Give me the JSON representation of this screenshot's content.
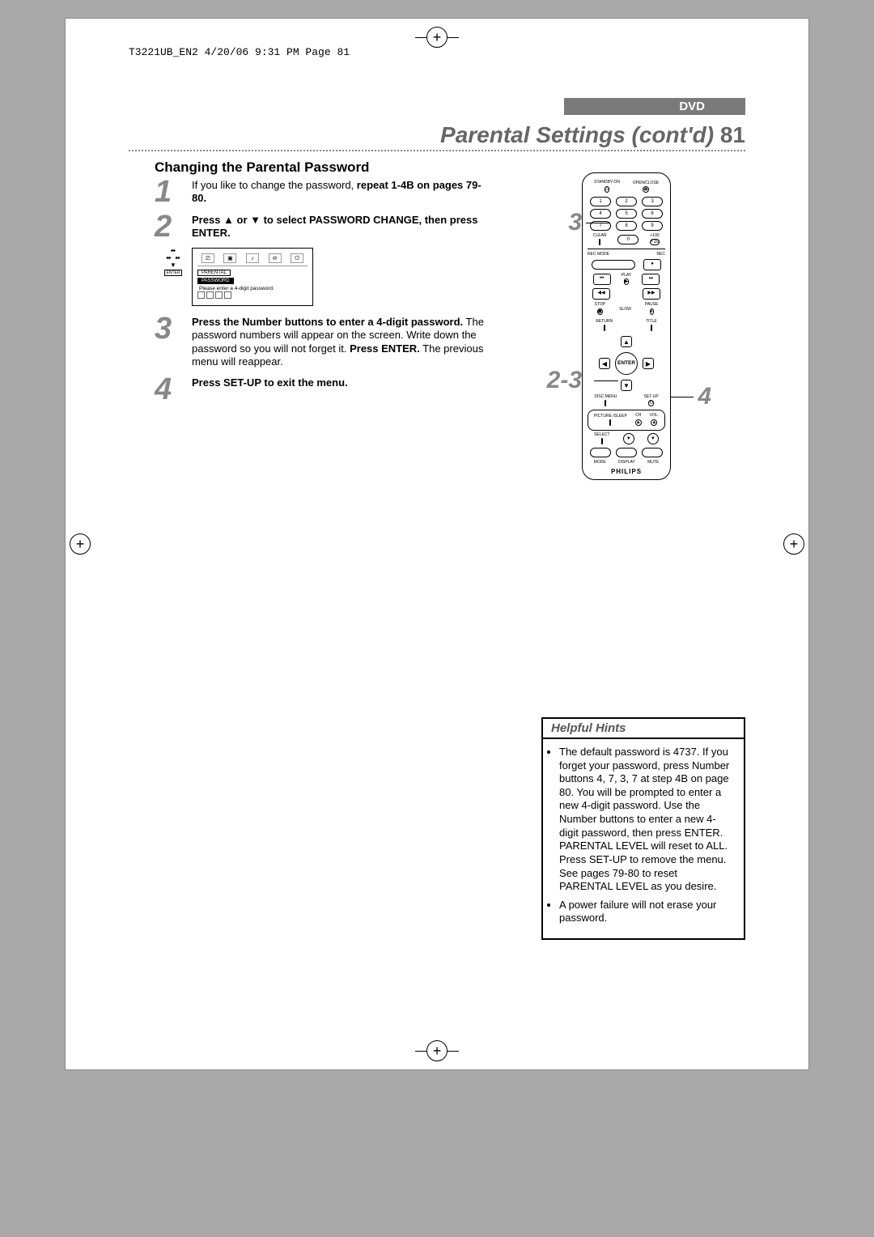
{
  "header": {
    "slug": "T3221UB_EN2  4/20/06  9:31 PM  Page 81",
    "dvd_tag": "DVD",
    "title": "Parental Settings (cont'd)",
    "page_number": "81",
    "subhead": "Changing the Parental Password"
  },
  "steps": {
    "s1": {
      "num": "1",
      "text_pre": "If you like to change the password, ",
      "text_bold": "repeat 1-4B on pages 79-80."
    },
    "s2": {
      "num": "2",
      "text_bold": "Press ▲ or ▼ to select PASSWORD CHANGE, then press ENTER."
    },
    "osd": {
      "tabs": "PARENTAL",
      "label_password": "PASSWORD",
      "prompt": "Please  enter  a  4-digit  password.",
      "hint_enter": "ENTER"
    },
    "s3": {
      "num": "3",
      "b1": "Press the Number buttons to enter a 4-digit password.",
      "t1": "  The password numbers will appear on the screen.  Write down the password so you will not forget it.  ",
      "b2": "Press ENTER.",
      "t2": "  The previous menu will reappear."
    },
    "s4": {
      "num": "4",
      "text_bold": "Press SET-UP to exit the menu."
    }
  },
  "callouts": {
    "top_left": "3",
    "mid_left": "2-3",
    "right": "4"
  },
  "remote": {
    "standby": "STANDBY-ON",
    "openclose": "OPEN/CLOSE",
    "standby_icon": "⏻",
    "eject_icon": "⏏",
    "nums": [
      "1",
      "2",
      "3",
      "4",
      "5",
      "6",
      "7",
      "8",
      "9",
      "0"
    ],
    "plus100": "+100",
    "plus10": "+10",
    "clear": "CLEAR",
    "recmode": "REC MODE",
    "rec": "REC",
    "rec_icon": "●",
    "prev": "⏮",
    "play_lbl": "PLAY",
    "play": "▶",
    "next": "⏭",
    "rew": "◀◀",
    "fwd": "▶▶",
    "stop_lbl": "STOP",
    "stop": "◼",
    "slow": "SLOW",
    "pause_lbl": "PAUSE",
    "pause": "⏸",
    "return": "RETURN",
    "title": "TITLE",
    "enter": "ENTER",
    "up": "▲",
    "down": "▼",
    "left": "◀",
    "right": "▶",
    "disc": "DISC MENU",
    "setup": "SET-UP",
    "setup_icon": "↻",
    "picture": "PICTURE /SLEEP",
    "ch": "CH",
    "vol": "VOL.",
    "select": "SELECT",
    "mode": "MODE",
    "display": "DISPLAY",
    "mute": "MUTE",
    "brand": "PHILIPS"
  },
  "hints": {
    "head": "Helpful Hints",
    "b1": "The default password is 4737. If you forget your password, press Number buttons 4, 7, 3, 7 at step 4B on page 80. You will be prompted to enter a new 4-digit password.  Use the Number buttons to enter a new 4-digit password, then press ENTER. PARENTAL LEVEL will reset to ALL. Press SET-UP to remove the menu. See pages 79-80 to reset PARENTAL LEVEL as you desire.",
    "b2": "A power failure will not erase your password."
  }
}
